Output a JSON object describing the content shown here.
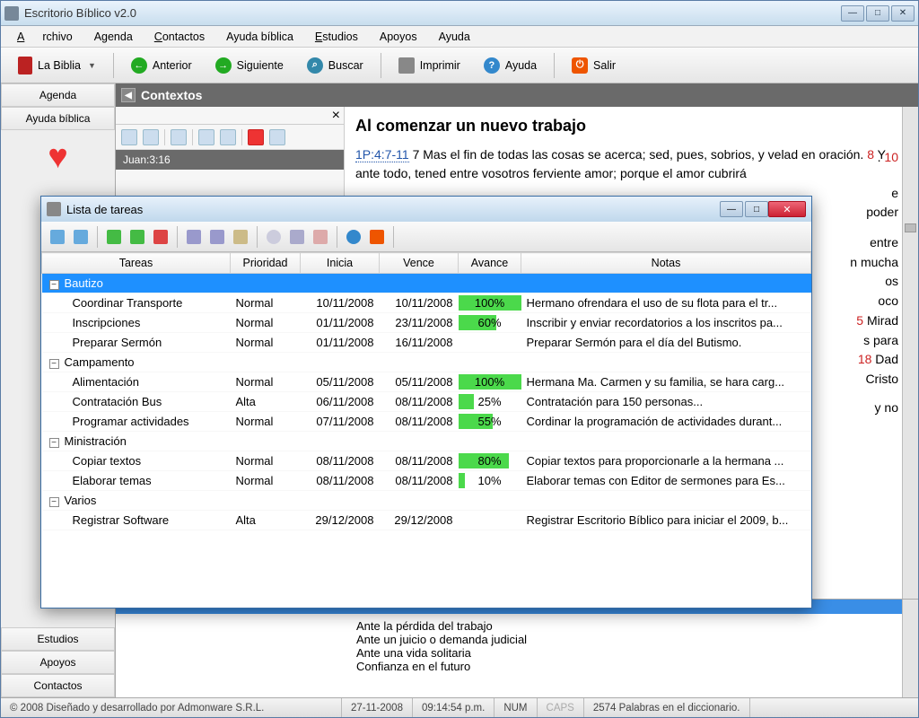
{
  "app": {
    "title": "Escritorio Bíblico v2.0"
  },
  "menu": {
    "archivo": "Archivo",
    "agenda": "Agenda",
    "contactos": "Contactos",
    "ayuda_biblica": "Ayuda bíblica",
    "estudios": "Estudios",
    "apoyos": "Apoyos",
    "ayuda": "Ayuda"
  },
  "toolbar": {
    "biblia": "La Biblia",
    "anterior": "Anterior",
    "siguiente": "Siguiente",
    "buscar": "Buscar",
    "imprimir": "Imprimir",
    "ayuda": "Ayuda",
    "salir": "Salir"
  },
  "sidebar": {
    "agenda": "Agenda",
    "ayuda_biblica": "Ayuda bíblica",
    "estudios": "Estudios",
    "apoyos": "Apoyos",
    "contactos": "Contactos"
  },
  "contextos": {
    "title": "Contextos"
  },
  "reference": {
    "text": "Juan:3:16"
  },
  "article": {
    "title": "Al comenzar un nuevo trabajo",
    "ref": "1P:4:7-11",
    "verse7": "7",
    "body7": " Mas el fin de todas las cosas se acerca; sed, pues, sobrios, y velad en oración. ",
    "verse8": "8",
    "body8": " Y ante todo, tened entre vosotros ferviente amor; porque el amor cubrirá",
    "frag10": "10",
    "frag_entre": " entre",
    "frag_mucha": "n mucha",
    "frag_os": "os",
    "frag_oco": "oco",
    "frag15": "5",
    "frag_mirad": " Mirad",
    "frag_para": "s para",
    "frag18": "18",
    "frag_dad": " Dad",
    "frag_cristo": "Cristo",
    "frag_yno": "y no"
  },
  "bottom_topics": {
    "l1": "Ante la pérdida del trabajo",
    "l2": "Ante un juicio o demanda judicial",
    "l3": "Ante una vida solitaria",
    "l4": "Confianza en el futuro"
  },
  "status": {
    "copyright": "© 2008 Diseñado y desarrollado por Admonware S.R.L.",
    "date": "27-11-2008",
    "time": "09:14:54 p.m.",
    "num": "NUM",
    "caps": "CAPS",
    "words": "2574 Palabras en el diccionario."
  },
  "dialog": {
    "title": "Lista de tareas",
    "columns": {
      "tareas": "Tareas",
      "prioridad": "Prioridad",
      "inicia": "Inicia",
      "vence": "Vence",
      "avance": "Avance",
      "notas": "Notas"
    },
    "groups": [
      {
        "name": "Bautizo",
        "expanded": true,
        "selected": true,
        "rows": [
          {
            "task": "Coordinar Transporte",
            "priority": "Normal",
            "start": "10/11/2008",
            "due": "10/11/2008",
            "progress": 100,
            "notes": "Hermano ofrendara el uso de su flota para el tr..."
          },
          {
            "task": "Inscripciones",
            "priority": "Normal",
            "start": "01/11/2008",
            "due": "23/11/2008",
            "progress": 60,
            "notes": "Inscribir y enviar recordatorios a los inscritos pa..."
          },
          {
            "task": "Preparar Sermón",
            "priority": "Normal",
            "start": "01/11/2008",
            "due": "16/11/2008",
            "progress": null,
            "notes": "Preparar Sermón para el día del Butismo."
          }
        ]
      },
      {
        "name": "Campamento",
        "expanded": true,
        "rows": [
          {
            "task": "Alimentación",
            "priority": "Normal",
            "start": "05/11/2008",
            "due": "05/11/2008",
            "progress": 100,
            "notes": "Hermana Ma. Carmen y su familia, se hara carg..."
          },
          {
            "task": "Contratación Bus",
            "priority": "Alta",
            "start": "06/11/2008",
            "due": "08/11/2008",
            "progress": 25,
            "notes": "Contratación para 150 personas..."
          },
          {
            "task": "Programar actividades",
            "priority": "Normal",
            "start": "07/11/2008",
            "due": "08/11/2008",
            "progress": 55,
            "notes": "Cordinar la programación de actividades durant..."
          }
        ]
      },
      {
        "name": "Ministración",
        "expanded": true,
        "rows": [
          {
            "task": "Copiar textos",
            "priority": "Normal",
            "start": "08/11/2008",
            "due": "08/11/2008",
            "progress": 80,
            "notes": "Copiar textos para proporcionarle a la hermana ..."
          },
          {
            "task": "Elaborar temas",
            "priority": "Normal",
            "start": "08/11/2008",
            "due": "08/11/2008",
            "progress": 10,
            "notes": "Elaborar temas con Editor de sermones para Es..."
          }
        ]
      },
      {
        "name": "Varios",
        "expanded": true,
        "rows": [
          {
            "task": "Registrar Software",
            "priority": "Alta",
            "start": "29/12/2008",
            "due": "29/12/2008",
            "progress": null,
            "notes": "Registrar Escritorio Bíblico para iniciar el 2009, b..."
          }
        ]
      }
    ]
  }
}
